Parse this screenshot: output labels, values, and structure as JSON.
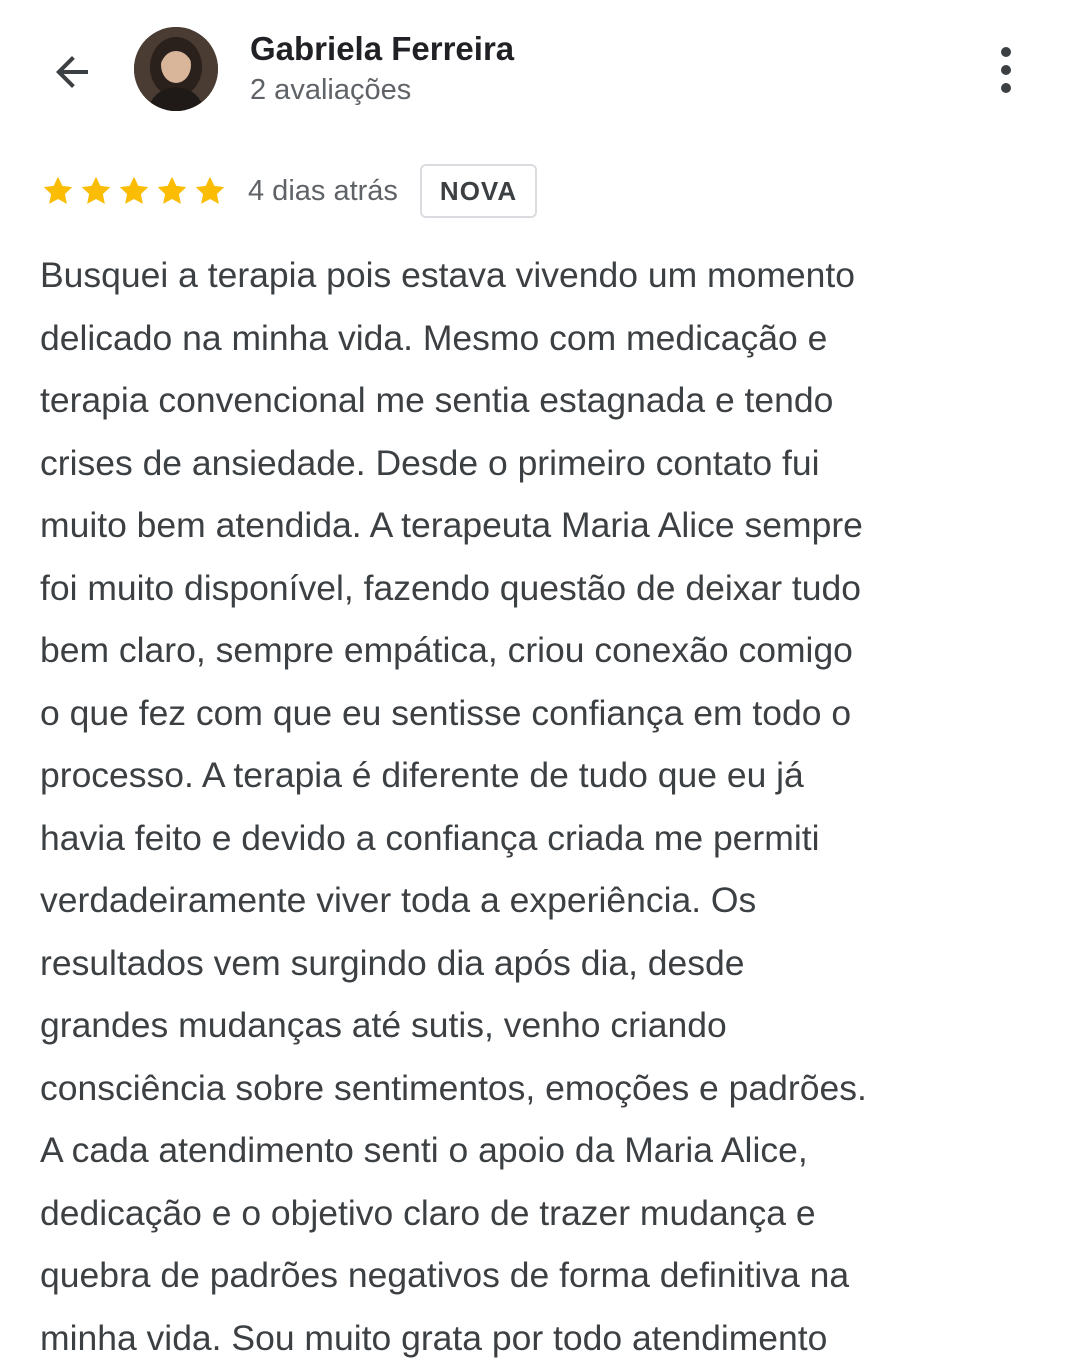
{
  "header": {
    "back_icon": "arrow-left-icon",
    "user_name": "Gabriela Ferreira",
    "user_meta": "2 avaliações",
    "more_icon": "more-vertical-icon"
  },
  "review": {
    "rating": 5,
    "rating_max": 5,
    "star_color": "#fbbc04",
    "date": "4 dias atrás",
    "badge": "NOVA",
    "lines": [
      "Busquei a terapia pois estava vivendo um momento",
      "delicado na minha vida. Mesmo com medicação e",
      "terapia convencional me sentia estagnada e tendo",
      "crises de ansiedade. Desde o primeiro contato fui",
      "muito bem atendida. A terapeuta Maria Alice sempre",
      "foi muito disponível, fazendo questão de deixar tudo",
      "bem claro, sempre empática, criou conexão comigo",
      "o que fez com que eu sentisse confiança em todo o",
      "processo. A terapia é diferente de tudo que eu já",
      "havia feito e devido a confiança criada me permiti",
      "verdadeiramente viver toda a experiência. Os",
      "resultados vem surgindo dia após dia, desde",
      "grandes mudanças até sutis, venho criando",
      "consciência sobre sentimentos, emoções e padrões.",
      "A cada atendimento senti o apoio da Maria Alice,",
      "dedicação e o objetivo claro de trazer mudança e",
      "quebra de padrões negativos de forma definitiva na",
      "minha vida. Sou muito grata por todo atendimento"
    ]
  }
}
